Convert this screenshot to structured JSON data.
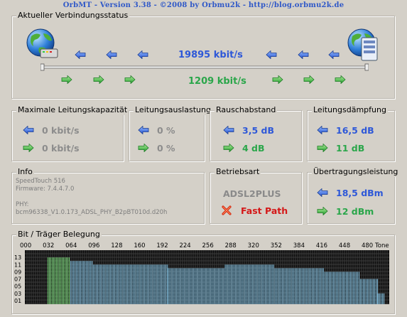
{
  "window": {
    "title": "OrbMT - Version 3.38 - ©2008 by Orbmu2k - http://blog.orbmu2k.de"
  },
  "connection_status": {
    "label": "Aktueller Verbindungsstatus",
    "down_rate": "19895 kbit/s",
    "up_rate": "1209 kbit/s"
  },
  "max_capacity": {
    "label": "Maximale Leitungskapazität",
    "down": "0 kbit/s",
    "up": "0 kbit/s"
  },
  "utilization": {
    "label": "Leitungsauslastung",
    "down": "0 %",
    "up": "0 %"
  },
  "snr": {
    "label": "Rauschabstand",
    "down": "3,5 dB",
    "up": "4 dB"
  },
  "attenuation": {
    "label": "Leitungsdämpfung",
    "down": "16,5 dB",
    "up": "11 dB"
  },
  "info": {
    "label": "Info",
    "device": "SpeedTouch 516",
    "firmware": "Firmware: 7.4.4.7.0",
    "phy_label": "PHY:",
    "phy_value": "bcm96338_V1.0.173_ADSL_PHY_B2pBT010d.d20h"
  },
  "mode": {
    "label": "Betriebsart",
    "standard": "ADSL2PLUS",
    "fast_path": "Fast Path"
  },
  "power": {
    "label": "Übertragungsleistung",
    "down": "18,5 dBm",
    "up": "12 dBm"
  },
  "bitloading": {
    "label": "Bit / Träger Belegung",
    "x_ticks": [
      "000",
      "032",
      "064",
      "096",
      "128",
      "160",
      "192",
      "224",
      "256",
      "288",
      "320",
      "352",
      "384",
      "416",
      "448",
      "480"
    ],
    "x_unit_label": "Tone",
    "y_ticks": [
      "13",
      "11",
      "09",
      "07",
      "05",
      "03",
      "01"
    ]
  },
  "chart_data": {
    "type": "bar",
    "title": "Bit / Träger Belegung",
    "xlabel": "Tone",
    "ylabel": "",
    "xlim": [
      0,
      511
    ],
    "ylim": [
      0,
      15
    ],
    "series": [
      {
        "color": "#7ee07e",
        "segments": [
          {
            "from": 32,
            "to": 63,
            "bits": 13
          }
        ]
      },
      {
        "color": "#86c6e8",
        "segments": [
          {
            "from": 64,
            "to": 95,
            "bits": 12
          },
          {
            "from": 96,
            "to": 200,
            "bits": 11
          },
          {
            "from": 201,
            "to": 280,
            "bits": 10
          },
          {
            "from": 281,
            "to": 350,
            "bits": 11
          },
          {
            "from": 351,
            "to": 420,
            "bits": 10
          },
          {
            "from": 421,
            "to": 470,
            "bits": 9
          },
          {
            "from": 471,
            "to": 495,
            "bits": 7
          },
          {
            "from": 496,
            "to": 505,
            "bits": 3
          }
        ]
      }
    ]
  },
  "colors": {
    "background": "#d4d0c8",
    "title": "#2f58c8",
    "down_value": "#2e58d8",
    "up_value": "#2aa64a",
    "inactive_value": "#8c8c8c",
    "fast_path": "#d41818",
    "upstream_bits": "#7ee07e",
    "downstream_bits": "#86c6e8",
    "chart_bg": "#101010"
  },
  "icons": {
    "down_arrow": "blue-left-arrow-icon",
    "up_arrow": "green-right-arrow-icon",
    "globe_modem": "globe-modem-icon",
    "globe_server": "globe-server-icon",
    "disabled": "red-x-icon"
  }
}
